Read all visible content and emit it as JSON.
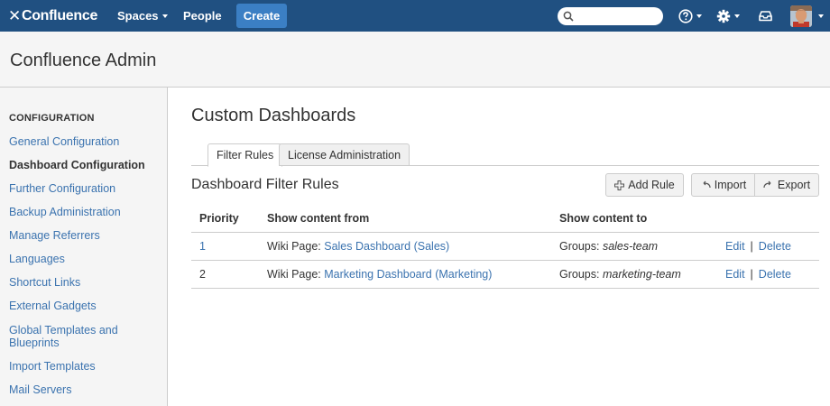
{
  "topnav": {
    "logo_text": "Confluence",
    "spaces_label": "Spaces",
    "people_label": "People",
    "create_label": "Create",
    "search_placeholder": "",
    "help_icon": "help-icon",
    "settings_icon": "gear-icon",
    "inbox_icon": "inbox-icon"
  },
  "header": {
    "title": "Confluence Admin"
  },
  "sidebar": {
    "heading": "CONFIGURATION",
    "items": [
      {
        "label": "General Configuration",
        "active": false
      },
      {
        "label": "Dashboard Configuration",
        "active": true
      },
      {
        "label": "Further Configuration",
        "active": false
      },
      {
        "label": "Backup Administration",
        "active": false
      },
      {
        "label": "Manage Referrers",
        "active": false
      },
      {
        "label": "Languages",
        "active": false
      },
      {
        "label": "Shortcut Links",
        "active": false
      },
      {
        "label": "External Gadgets",
        "active": false
      },
      {
        "label": "Global Templates and Blueprints",
        "active": false
      },
      {
        "label": "Import Templates",
        "active": false
      },
      {
        "label": "Mail Servers",
        "active": false
      }
    ]
  },
  "main": {
    "title": "Custom Dashboards",
    "tabs": [
      {
        "label": "Filter Rules",
        "active": true
      },
      {
        "label": "License Administration",
        "active": false
      }
    ],
    "section_title": "Dashboard Filter Rules",
    "buttons": {
      "add_rule": "Add Rule",
      "import": "Import",
      "export": "Export"
    },
    "table": {
      "headers": [
        "Priority",
        "Show content from",
        "Show content to",
        ""
      ],
      "rows": [
        {
          "priority": "1",
          "from_prefix": "Wiki Page:",
          "from_link": "Sales Dashboard (Sales)",
          "to_prefix": "Groups:",
          "to_group": "sales-team",
          "edit": "Edit",
          "delete": "Delete"
        },
        {
          "priority": "2",
          "from_prefix": "Wiki Page:",
          "from_link": "Marketing Dashboard (Marketing)",
          "to_prefix": "Groups:",
          "to_group": "marketing-team",
          "edit": "Edit",
          "delete": "Delete"
        }
      ],
      "action_separator": "|"
    }
  },
  "colors": {
    "nav_bg": "#205081",
    "create_bg": "#3b7fc4",
    "link": "#3b73af",
    "sidebar_bg": "#f5f5f5"
  }
}
